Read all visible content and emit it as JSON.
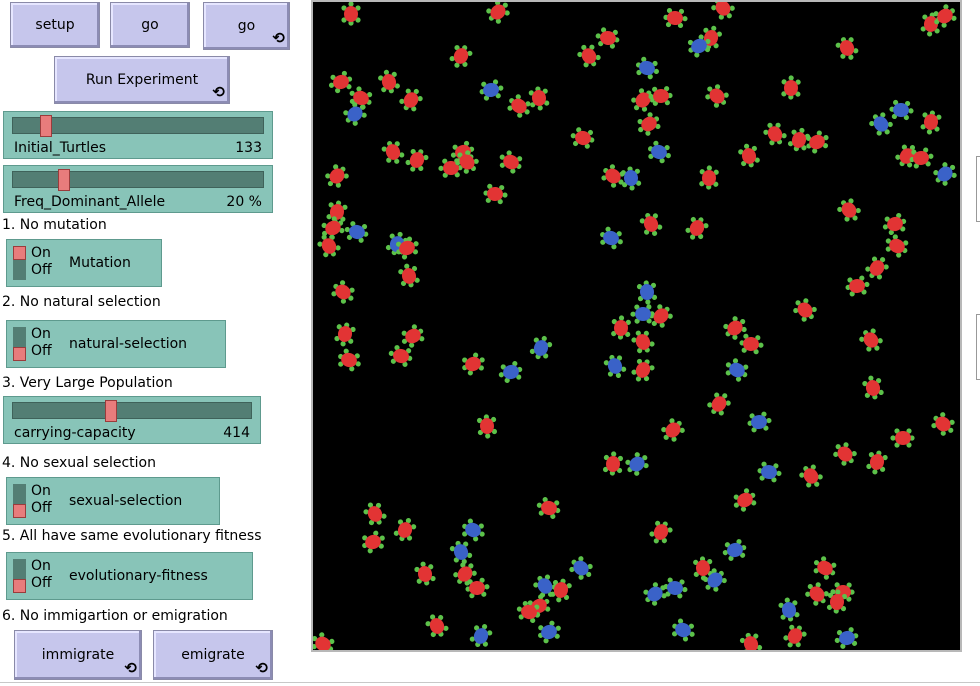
{
  "buttons": {
    "setup": "setup",
    "go_once": "go",
    "go_forever": "go",
    "run_experiment": "Run Experiment",
    "immigrate": "immigrate",
    "emigrate": "emigrate",
    "loop_glyph": "⟲"
  },
  "sliders": {
    "initial_turtles": {
      "name": "Initial_Turtles",
      "value": "133",
      "fraction": 0.133
    },
    "freq_dominant": {
      "name": "Freq_Dominant_Allele",
      "value": "20 %",
      "fraction": 0.2
    },
    "carrying_capacity": {
      "name": "carrying-capacity",
      "value": "414",
      "fraction": 0.414
    }
  },
  "notes": {
    "n1": "1. No mutation",
    "n2": "2. No natural selection",
    "n3": "3. Very Large Population",
    "n4": "4. No sexual selection",
    "n5": "5. All have same evolutionary fitness",
    "n6": "6. No immigartion or emigration"
  },
  "switches": {
    "on_label": "On",
    "off_label": "Off",
    "mutation": {
      "label": "Mutation",
      "state": "on"
    },
    "natural_selection": {
      "label": "natural-selection",
      "state": "off"
    },
    "sexual_selection": {
      "label": "sexual-selection",
      "state": "off"
    },
    "evolutionary_fitness": {
      "label": "evolutionary-fitness",
      "state": "off"
    }
  },
  "world": {
    "background": "#000000",
    "turtle_colors": {
      "dominant": "#3a62c8",
      "recessive": "#e23434",
      "limbs": "#5cc24a"
    }
  }
}
